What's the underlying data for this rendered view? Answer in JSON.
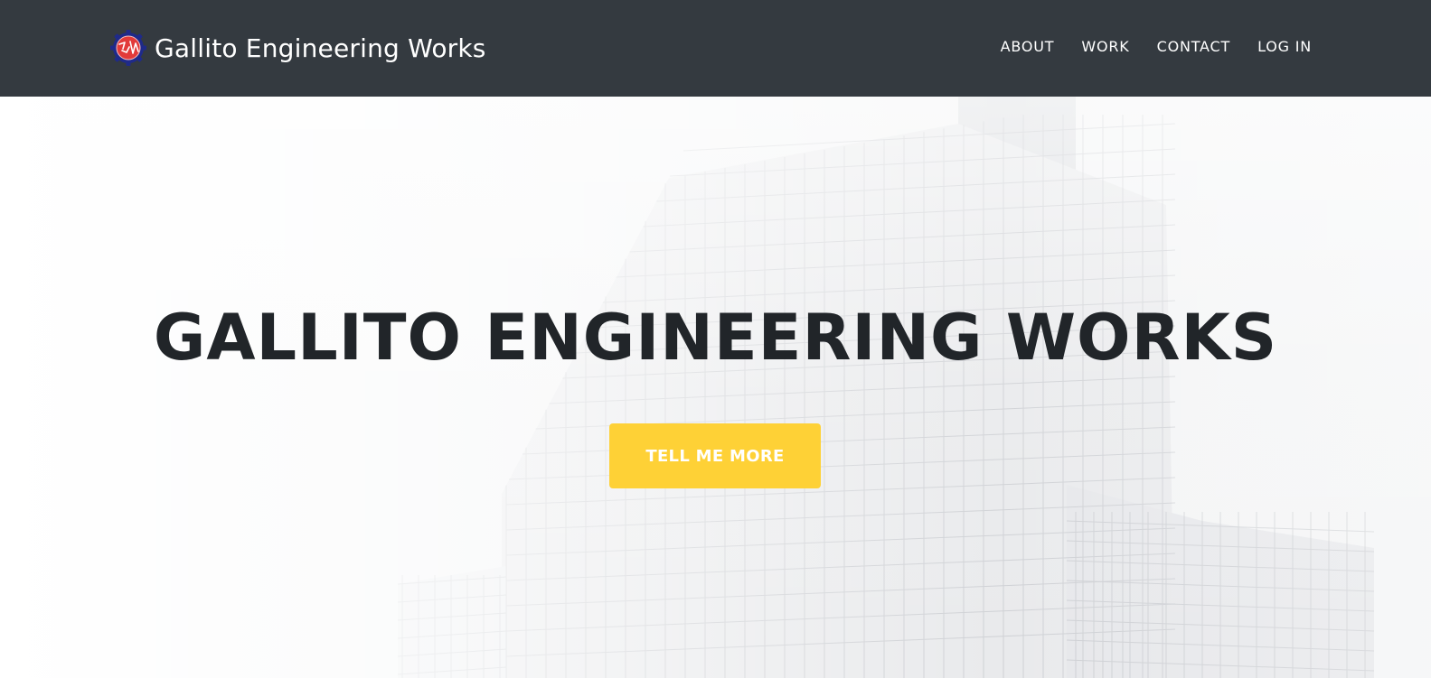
{
  "colors": {
    "navbar_bg": "#343a40",
    "nav_text": "#ffffff",
    "hero_title": "#212529",
    "accent_button": "#fed136"
  },
  "navbar": {
    "brand": {
      "logo_icon": "gear-logo-icon",
      "title": "Gallito Engineering Works"
    },
    "links": [
      {
        "label": "ABOUT"
      },
      {
        "label": "WORK"
      },
      {
        "label": "CONTACT"
      },
      {
        "label": "LOG IN"
      }
    ]
  },
  "hero": {
    "background": "building-wireframe-sketch",
    "title": "GALLITO ENGINEERING WORKS",
    "cta_label": "TELL ME MORE"
  }
}
